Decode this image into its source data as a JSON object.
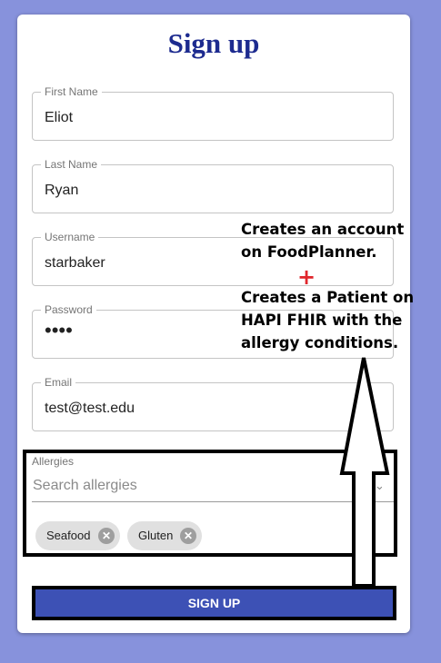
{
  "form": {
    "title": "Sign up",
    "fields": [
      {
        "label": "First Name",
        "value": "Eliot"
      },
      {
        "label": "Last Name",
        "value": "Ryan"
      },
      {
        "label": "Username",
        "value": "starbaker"
      },
      {
        "label": "Password",
        "value": "••••"
      },
      {
        "label": "Email",
        "value": "test@test.edu"
      }
    ],
    "allergies": {
      "label": "Allergies",
      "placeholder": "Search allergies",
      "chips": [
        "Seafood",
        "Gluten"
      ]
    },
    "submit_label": "SIGN UP"
  },
  "annotation": {
    "line1": "Creates an account",
    "line2": "on FoodPlanner.",
    "plus": "+",
    "line3": "Creates a Patient on",
    "line4": "HAPI FHIR with the",
    "line5": "allergy conditions.",
    "plus_color": "#e0262c"
  },
  "colors": {
    "background": "#8792dc",
    "title": "#1d2b8f",
    "button": "#3d51b5"
  }
}
